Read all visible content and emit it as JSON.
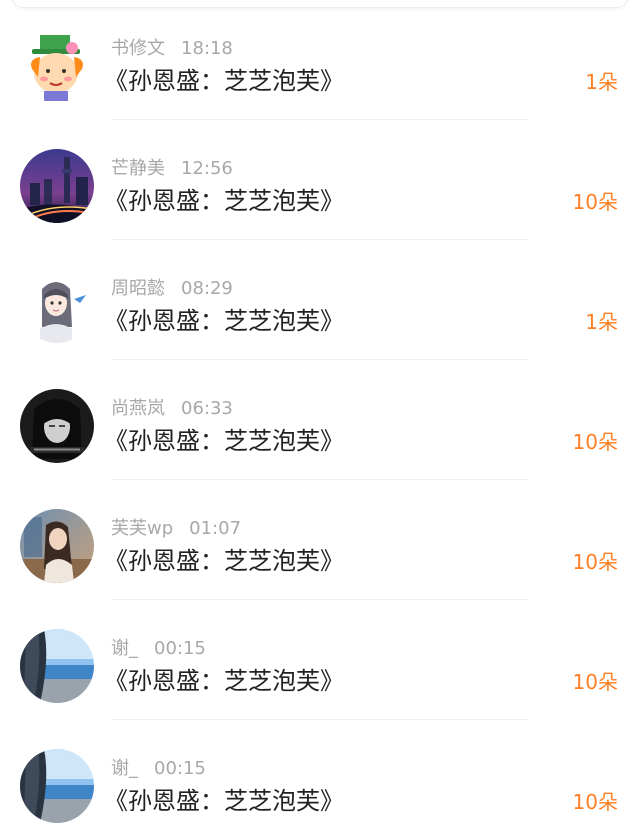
{
  "rows": [
    {
      "name": "书修文",
      "time": "18:18",
      "title": "《孙恩盛：芝芝泡芙》",
      "count": "1朵",
      "avatar_icon": "cartoon-clown-avatar-icon"
    },
    {
      "name": "芒静美",
      "time": "12:56",
      "title": "《孙恩盛：芝芝泡芙》",
      "count": "10朵",
      "avatar_icon": "city-night-avatar-icon"
    },
    {
      "name": "周昭懿",
      "time": "08:29",
      "title": "《孙恩盛：芝芝泡芙》",
      "count": "1朵",
      "avatar_icon": "anime-girl-avatar-icon"
    },
    {
      "name": "尚燕岚",
      "time": "06:33",
      "title": "《孙恩盛：芝芝泡芙》",
      "count": "10朵",
      "avatar_icon": "dark-portrait-avatar-icon"
    },
    {
      "name": "芙芙wp",
      "time": "01:07",
      "title": "《孙恩盛：芝芝泡芙》",
      "count": "10朵",
      "avatar_icon": "girl-photo-avatar-icon"
    },
    {
      "name": "谢_",
      "time": "00:15",
      "title": "《孙恩盛：芝芝泡芙》",
      "count": "10朵",
      "avatar_icon": "sea-photo-avatar-icon"
    },
    {
      "name": "谢_",
      "time": "00:15",
      "title": "《孙恩盛：芝芝泡芙》",
      "count": "10朵",
      "avatar_icon": "sea-photo-avatar-icon"
    }
  ],
  "colors": {
    "count_orange": "#ff7f24",
    "meta_gray": "#a8a8a8",
    "title_dark": "#222222"
  }
}
